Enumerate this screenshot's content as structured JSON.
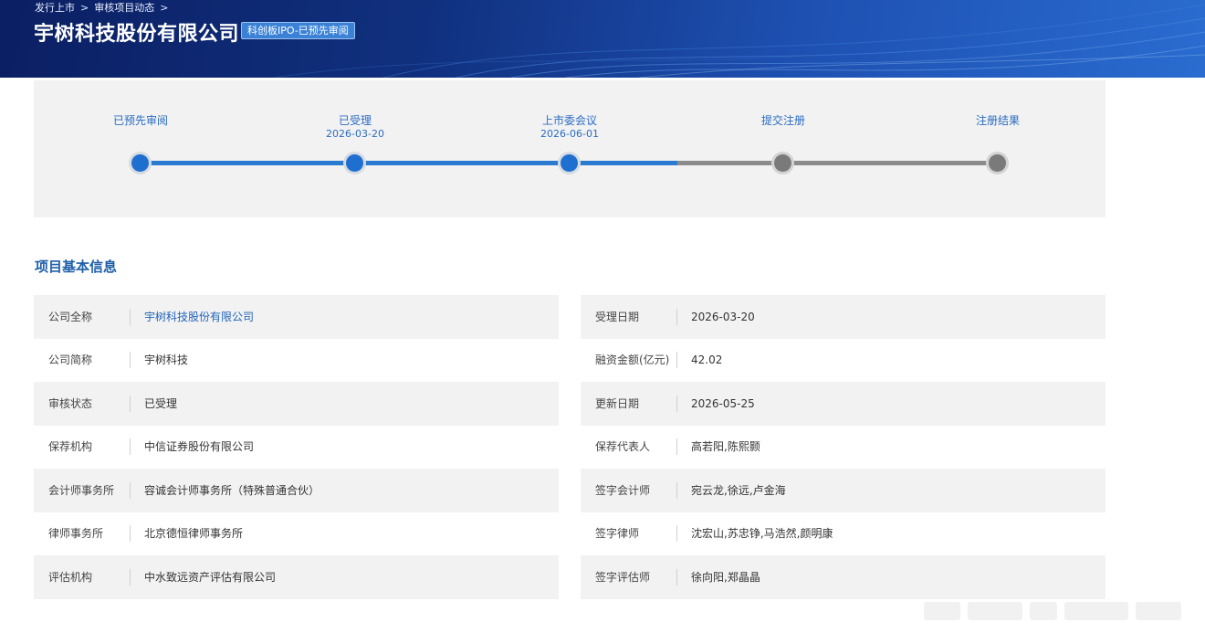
{
  "header": {
    "breadcrumb": [
      "发行上市",
      "审核项目动态"
    ],
    "breadcrumb_sep": ">",
    "company_name": "宇树科技股份有限公司",
    "badge": "科创板IPO-已预先审阅"
  },
  "progress": {
    "steps": [
      {
        "label": "已预先审阅",
        "date": "",
        "status": "done"
      },
      {
        "label": "已受理",
        "date": "2026-03-20",
        "status": "done"
      },
      {
        "label": "上市委会议",
        "date": "2026-06-01",
        "status": "done"
      },
      {
        "label": "提交注册",
        "date": "",
        "status": "todo"
      },
      {
        "label": "注册结果",
        "date": "",
        "status": "todo"
      }
    ]
  },
  "section": {
    "title": "项目基本信息"
  },
  "info_left": [
    {
      "label": "公司全称",
      "value": "宇树科技股份有限公司"
    },
    {
      "label": "公司简称",
      "value": "宇树科技"
    },
    {
      "label": "审核状态",
      "value": "已受理"
    },
    {
      "label": "保荐机构",
      "value": "中信证券股份有限公司"
    },
    {
      "label": "会计师事务所",
      "value": "容诚会计师事务所（特殊普通合伙）"
    },
    {
      "label": "律师事务所",
      "value": "北京德恒律师事务所"
    },
    {
      "label": "评估机构",
      "value": "中水致远资产评估有限公司"
    }
  ],
  "info_right": [
    {
      "label": "受理日期",
      "value": "2026-03-20"
    },
    {
      "label": "融资金额(亿元)",
      "value": "42.02"
    },
    {
      "label": "更新日期",
      "value": "2026-05-25"
    },
    {
      "label": "保荐代表人",
      "value": "高若阳,陈熙颢"
    },
    {
      "label": "签字会计师",
      "value": "宛云龙,徐远,卢金海"
    },
    {
      "label": "签字律师",
      "value": "沈宏山,苏忠铮,马浩然,颜明康"
    },
    {
      "label": "签字评估师",
      "value": "徐向阳,郑晶晶"
    }
  ],
  "colors": {
    "accent": "#1f6fd0",
    "done_track": "#2a7ad0",
    "todo_track": "#8c8c8c",
    "banner_dark": "#0b1f63",
    "section_title": "#1f5fa8"
  }
}
